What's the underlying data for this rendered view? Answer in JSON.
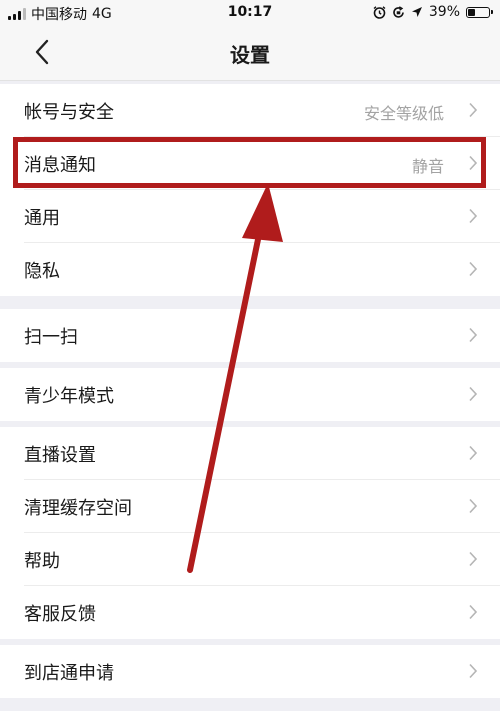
{
  "status_bar": {
    "carrier": "中国移动",
    "network": "4G",
    "time": "10:17",
    "battery_percent": "39%",
    "battery_level": 0.39,
    "icons": [
      "alarm-icon",
      "orientation-lock-icon",
      "location-icon",
      "battery-icon"
    ]
  },
  "nav": {
    "title": "设置",
    "back_icon": "chevron-left-icon"
  },
  "groups": [
    {
      "items": [
        {
          "label": "帐号与安全",
          "value": "安全等级低"
        },
        {
          "label": "消息通知",
          "value": "静音"
        },
        {
          "label": "通用",
          "value": ""
        },
        {
          "label": "隐私",
          "value": ""
        }
      ]
    },
    {
      "items": [
        {
          "label": "扫一扫",
          "value": ""
        }
      ]
    },
    {
      "items": [
        {
          "label": "青少年模式",
          "value": ""
        }
      ]
    },
    {
      "items": [
        {
          "label": "直播设置",
          "value": ""
        },
        {
          "label": "清理缓存空间",
          "value": ""
        },
        {
          "label": "帮助",
          "value": ""
        },
        {
          "label": "客服反馈",
          "value": ""
        }
      ]
    },
    {
      "items": [
        {
          "label": "到店通申请",
          "value": ""
        }
      ]
    }
  ],
  "annotation": {
    "color": "#b01c1c",
    "highlighted_item": "消息通知"
  }
}
